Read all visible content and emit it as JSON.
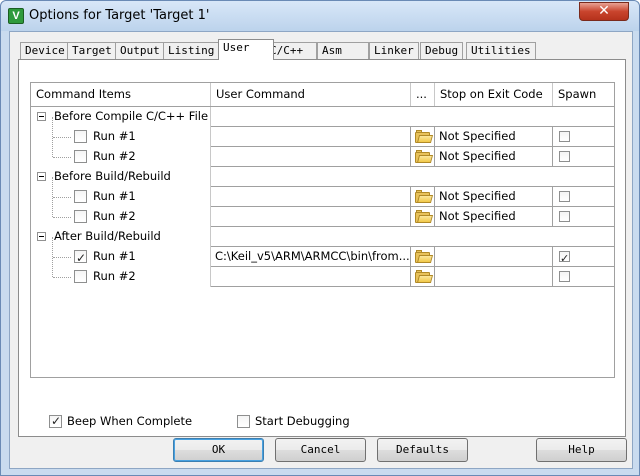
{
  "window": {
    "title": "Options for Target 'Target 1'",
    "app_icon_letter": "V",
    "close_glyph": "✕"
  },
  "tabs": [
    {
      "label": "Device"
    },
    {
      "label": "Target"
    },
    {
      "label": "Output"
    },
    {
      "label": "Listing"
    },
    {
      "label": "User",
      "active": true
    },
    {
      "label": "C/C++"
    },
    {
      "label": "Asm"
    },
    {
      "label": "Linker"
    },
    {
      "label": "Debug"
    },
    {
      "label": "Utilities"
    }
  ],
  "grid": {
    "headers": {
      "items": "Command Items",
      "command": "User Command",
      "browse": "...",
      "stop": "Stop on Exit Code",
      "spawn": "Spawn"
    },
    "groups": [
      {
        "label": "Before Compile C/C++ File",
        "runs": [
          {
            "label": "Run #1",
            "checked": false,
            "command": "",
            "stop": "Not Specified",
            "spawn": false
          },
          {
            "label": "Run #2",
            "checked": false,
            "command": "",
            "stop": "Not Specified",
            "spawn": false
          }
        ]
      },
      {
        "label": "Before Build/Rebuild",
        "runs": [
          {
            "label": "Run #1",
            "checked": false,
            "command": "",
            "stop": "Not Specified",
            "spawn": false
          },
          {
            "label": "Run #2",
            "checked": false,
            "command": "",
            "stop": "Not Specified",
            "spawn": false
          }
        ]
      },
      {
        "label": "After Build/Rebuild",
        "runs": [
          {
            "label": "Run #1",
            "checked": true,
            "command": "C:\\Keil_v5\\ARM\\ARMCC\\bin\\from...",
            "stop": "",
            "spawn": true
          },
          {
            "label": "Run #2",
            "checked": false,
            "command": "",
            "stop": "",
            "spawn": false
          }
        ]
      }
    ]
  },
  "options": {
    "beep_label": "Beep When Complete",
    "beep_checked": true,
    "debug_label": "Start Debugging",
    "debug_checked": false
  },
  "buttons": {
    "ok": "OK",
    "cancel": "Cancel",
    "defaults": "Defaults",
    "help": "Help"
  },
  "colors": {
    "title_bg": "#c9dbef",
    "close": "#c9442d",
    "folder": "#e8c25a"
  }
}
